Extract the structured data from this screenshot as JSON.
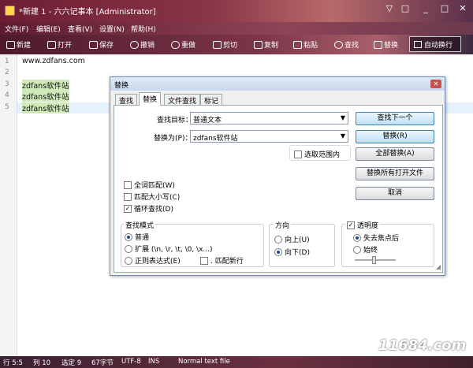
{
  "window": {
    "title": "*新建 1 - 六六记事本 [Administrator]",
    "controls": [
      "▽",
      "□",
      "_",
      "□",
      "✕"
    ]
  },
  "menu": [
    "文件(F)",
    "编辑(E)",
    "查看(V)",
    "设置(N)",
    "帮助(H)"
  ],
  "toolbar": {
    "new": "新建",
    "open": "打开",
    "save": "保存",
    "undo": "撤销",
    "redo": "重做",
    "cut": "剪切",
    "copy": "复制",
    "paste": "粘贴",
    "find": "查找",
    "replace": "替换",
    "wrap": "自动换行"
  },
  "editor": {
    "lines": [
      {
        "n": "1",
        "text": "www.zdfans.com"
      },
      {
        "n": "2",
        "text": ""
      },
      {
        "n": "3",
        "text": "zdfans软件站"
      },
      {
        "n": "4",
        "text": "zdfans软件站"
      },
      {
        "n": "5",
        "text": "zdfans软件站"
      }
    ]
  },
  "dialog": {
    "title": "替换",
    "tabs": [
      "查找",
      "替换",
      "文件查找",
      "标记"
    ],
    "find_label": "查找目标：",
    "find_value": "普通文本",
    "replace_label": "替换为(P)：",
    "replace_value": "zdfans软件站",
    "in_selection": "选取范围内",
    "buttons": {
      "find_next": "查找下一个",
      "replace": "替换(R)",
      "replace_all": "全部替换(A)",
      "replace_all_open": "替换所有打开文件",
      "cancel": "取消"
    },
    "options": {
      "whole_word": "全词匹配(W)",
      "match_case": "匹配大小写(C)",
      "wrap": "循环查找(D)"
    },
    "mode": {
      "title": "查找模式",
      "normal": "普通",
      "extended": "扩展 (\\n, \\r, \\t, \\0, \\x...)",
      "regex": "正则表达式(E)",
      "dot_newline": ". 匹配新行"
    },
    "direction": {
      "title": "方向",
      "up": "向上(U)",
      "down": "向下(D)"
    },
    "transparency": {
      "title": "透明度",
      "on_lose_focus": "失去焦点后",
      "always": "始终",
      "level": 0.55
    }
  },
  "status": {
    "pos": "行 5:5",
    "lines": "列 10",
    "sel": "选定 9",
    "chars": "67字节",
    "enc": "UTF-8",
    "ins": "INS",
    "type": "Normal text file"
  },
  "watermark": "11684.com"
}
